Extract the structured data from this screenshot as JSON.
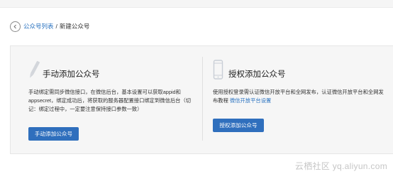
{
  "breadcrumb": {
    "parent": "公众号列表",
    "separator": "/",
    "current": "新建公众号"
  },
  "manual": {
    "icon": "pencil-icon",
    "title": "手动添加公众号",
    "description": "手动绑定需同步微信接口，在微信后台，基本设置可以获取appid和appsecret，绑定成功后，将获取的服务器配置接口绑定到微信后台（切记：绑定过程中，一定要注意保持接口参数一致）",
    "button_label": "手动添加公众号"
  },
  "authorize": {
    "icon": "phone-icon",
    "title": "授权添加公众号",
    "description": "使用授权登录需认证微信开放平台和全网发布，认证微信开放平台和全网发布教程",
    "link_label": "微信开放平台设置",
    "button_label": "授权添加公众号"
  },
  "watermark": "云栖社区 yq.aliyun.com",
  "colors": {
    "primary": "#2f6fbd",
    "link": "#2b73c0",
    "panel_bg": "#f6f6f6"
  }
}
